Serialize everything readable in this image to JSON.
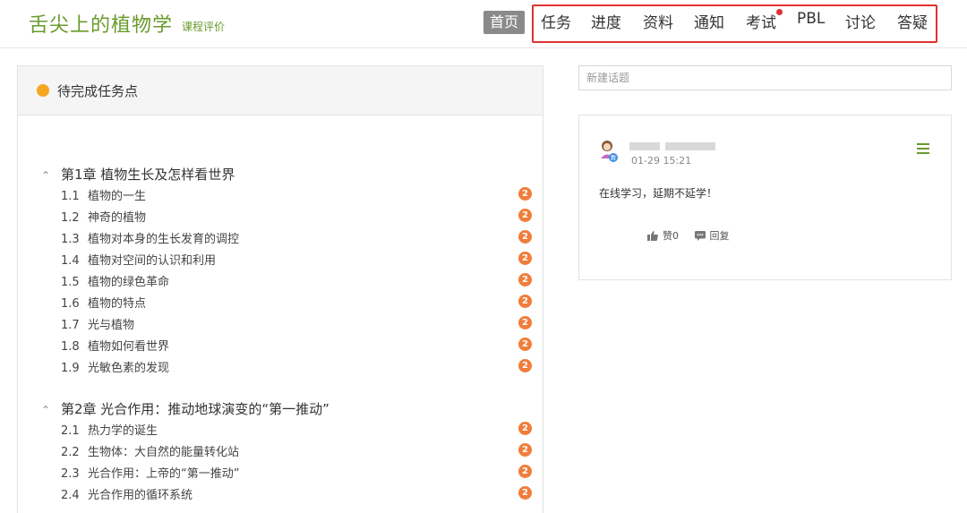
{
  "header": {
    "title": "舌尖上的植物学",
    "subtitle": "课程评价",
    "home": "首页",
    "nav": [
      "任务",
      "进度",
      "资料",
      "通知",
      "考试",
      "PBL",
      "讨论",
      "答疑"
    ]
  },
  "left": {
    "title": "待完成任务点",
    "badge": "2",
    "chapters": [
      {
        "title": "第1章 植物生长及怎样看世界",
        "lessons": [
          {
            "num": "1.1",
            "title": "植物的一生"
          },
          {
            "num": "1.2",
            "title": "神奇的植物"
          },
          {
            "num": "1.3",
            "title": "植物对本身的生长发育的调控"
          },
          {
            "num": "1.4",
            "title": "植物对空间的认识和利用"
          },
          {
            "num": "1.5",
            "title": "植物的绿色革命"
          },
          {
            "num": "1.6",
            "title": "植物的特点"
          },
          {
            "num": "1.7",
            "title": "光与植物"
          },
          {
            "num": "1.8",
            "title": "植物如何看世界"
          },
          {
            "num": "1.9",
            "title": "光敏色素的发现"
          }
        ]
      },
      {
        "title": "第2章 光合作用：推动地球演变的“第一推动”",
        "lessons": [
          {
            "num": "2.1",
            "title": "热力学的诞生"
          },
          {
            "num": "2.2",
            "title": "生物体：大自然的能量转化站"
          },
          {
            "num": "2.3",
            "title": "光合作用：上帝的“第一推动”"
          },
          {
            "num": "2.4",
            "title": "光合作用的循环系统"
          }
        ]
      }
    ]
  },
  "right": {
    "topic_placeholder": "新建话题",
    "post": {
      "time": "01-29 15:21",
      "content": "在线学习，延期不延学！",
      "like_label": "赞0",
      "reply_label": "回复"
    }
  },
  "colors": {
    "brand": "#6a9a2c",
    "highlight_border": "#e03131",
    "badge": "#f07d3a",
    "dot": "#f5a623"
  }
}
